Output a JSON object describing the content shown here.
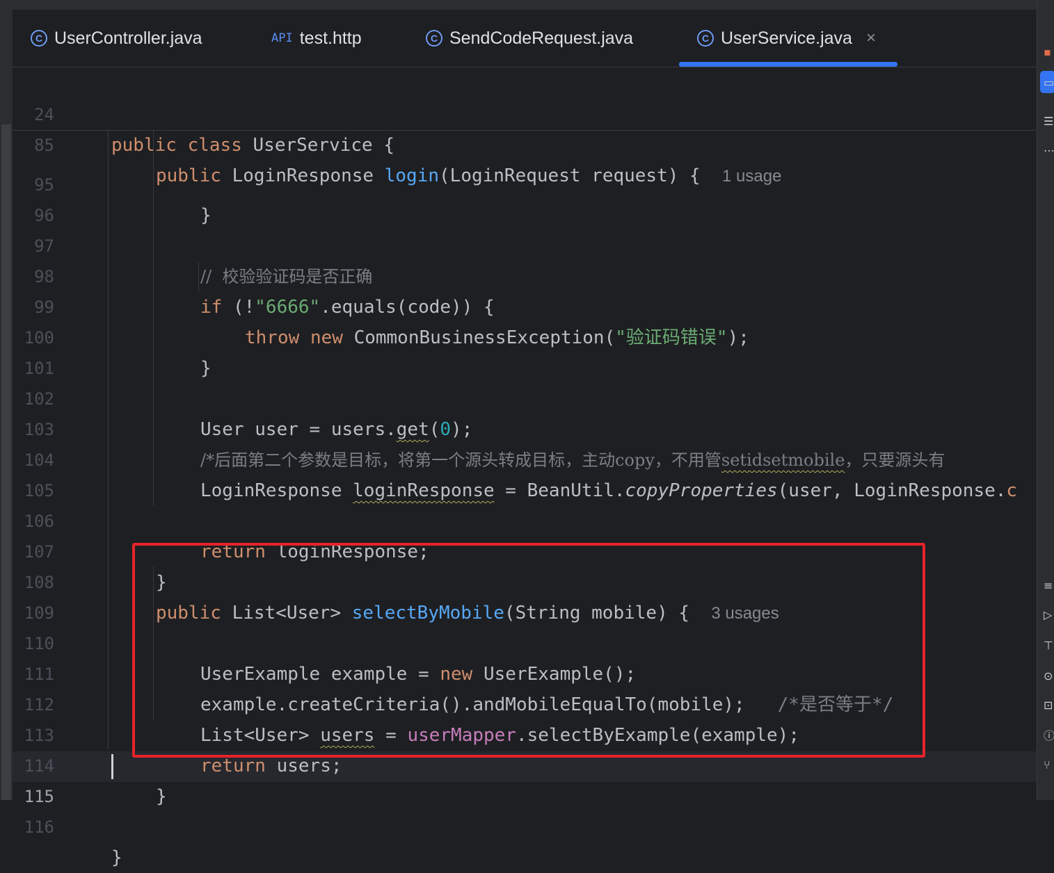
{
  "tabs": [
    {
      "icon": "class-icon",
      "label": "UserController.java"
    },
    {
      "icon": "api-icon",
      "icon_text": "API",
      "label": "test.http"
    },
    {
      "icon": "class-icon",
      "label": "SendCodeRequest.java"
    },
    {
      "icon": "class-icon",
      "label": "UserService.java",
      "active": true,
      "close": "×"
    }
  ],
  "sticky": {
    "l24": {
      "num": "24",
      "kw1": "public",
      "kw2": "class",
      "name": "UserService",
      "brace": "{"
    },
    "l85": {
      "num": "85",
      "kw1": "public",
      "type": "LoginResponse",
      "fn": "login",
      "params": "(LoginRequest request) {",
      "hint": "1 usage"
    }
  },
  "lines": {
    "l95": {
      "num": "95",
      "text": "}"
    },
    "l96": {
      "num": "96"
    },
    "l97": {
      "num": "97",
      "comment": "//  校验验证码是否正确"
    },
    "l98": {
      "num": "98",
      "kw": "if",
      "p1": " (!",
      "str": "\"6666\"",
      "p2": ".equals(code)) {"
    },
    "l99": {
      "num": "99",
      "kw1": "throw",
      "kw2": "new",
      "cls": "CommonBusinessException(",
      "str": "\"验证码错误\"",
      "end": ");"
    },
    "l100": {
      "num": "100",
      "text": "}"
    },
    "l101": {
      "num": "101"
    },
    "l102": {
      "num": "102",
      "p1": "User user = users.",
      "fn": "get",
      "p2": "(",
      "num0": "0",
      "p3": ");"
    },
    "l103": {
      "num": "103",
      "c1": "/*后面第二个参数是目标，将第一个源头转成目标，主动copy，不用管",
      "c2": "setidsetmobile",
      "c3": "，只要源头有"
    },
    "l104": {
      "num": "104",
      "p1": "LoginResponse ",
      "var": "loginResponse",
      "p2": " = BeanUtil.",
      "it": "copyProperties",
      "p3": "(user, LoginResponse.",
      "tail": "c"
    },
    "l105": {
      "num": "105"
    },
    "l106": {
      "num": "106",
      "kw": "return",
      "rest": " loginResponse;"
    },
    "l107": {
      "num": "107",
      "text": "}"
    },
    "l108": {
      "num": "108",
      "kw": "public",
      "p1": " List<User> ",
      "fn": "selectByMobile",
      "p2": "(String mobile) {",
      "hint": "3 usages"
    },
    "l109": {
      "num": "109"
    },
    "l110": {
      "num": "110",
      "p1": "UserExample example = ",
      "kw": "new",
      "p2": " UserExample();"
    },
    "l111": {
      "num": "111",
      "p1": "example.createCriteria().andMobileEqualTo(mobile);",
      "comment": "/*是否等于*/"
    },
    "l112": {
      "num": "112",
      "p1": "List<User> ",
      "var": "users",
      "p2": " = ",
      "field": "userMapper",
      "p3": ".selectByExample(example);"
    },
    "l113": {
      "num": "113",
      "kw": "return",
      "rest": " users;"
    },
    "l114": {
      "num": "114",
      "text": "}"
    },
    "l115": {
      "num": "115"
    },
    "l116": {
      "num": "116",
      "text": "}"
    }
  },
  "colors": {
    "background": "#1e1f22",
    "keyword": "#cf8e6d",
    "string": "#6aab73",
    "function": "#56a8f5",
    "comment": "#7a7e85",
    "field": "#c77dbb",
    "number": "#2aacb8",
    "accent": "#3574f0",
    "highlight_box": "#e8232a"
  },
  "right_toolbar_icons": [
    "notifications-icon",
    "project-icon",
    "structure-icon",
    "more-icon",
    "database-icon",
    "run-icon",
    "build-icon",
    "services-icon",
    "terminal-icon",
    "problems-icon",
    "git-icon"
  ]
}
